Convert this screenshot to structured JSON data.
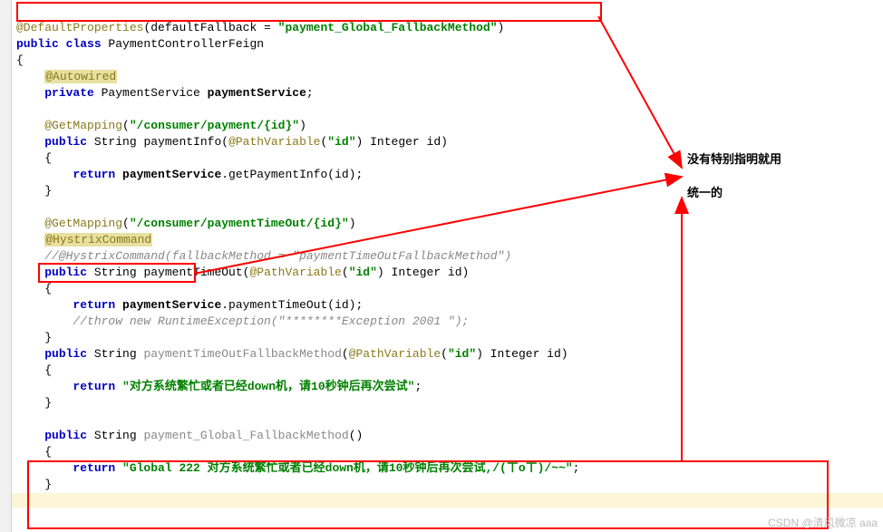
{
  "lines": {
    "l1a": "@DefaultProperties",
    "l1b": "(defaultFallback = ",
    "l1c": "\"payment_Global_FallbackMethod\"",
    "l1d": ")",
    "l2a": "public",
    "l2b": " class",
    "l2c": " PaymentControllerFeign",
    "l3": "{",
    "l4": "@Autowired",
    "l5a": "private",
    "l5b": " PaymentService ",
    "l5c": "paymentService",
    "l5d": ";",
    "l7a": "@GetMapping",
    "l7b": "(",
    "l7c": "\"/consumer/payment/{id}\"",
    "l7d": ")",
    "l8a": "public",
    "l8b": " String paymentInfo(",
    "l8c": "@PathVariable",
    "l8d": "(",
    "l8e": "\"id\"",
    "l8f": ") Integer id)",
    "l9": "{",
    "l10a": "return ",
    "l10b": "paymentService",
    "l10c": ".getPaymentInfo(id);",
    "l11": "}",
    "l13a": "@GetMapping",
    "l13b": "(",
    "l13c": "\"/consumer/paymentTimeOut/{id}\"",
    "l13d": ")",
    "l14": "@HystrixCommand",
    "l15": "//@HystrixCommand(fallbackMethod = \"paymentTimeOutFallbackMethod\")",
    "l16a": "public",
    "l16b": " String paymentTimeOut(",
    "l16c": "@PathVariable",
    "l16d": "(",
    "l16e": "\"id\"",
    "l16f": ") Integer id)",
    "l17": "{",
    "l18a": "return ",
    "l18b": "paymentService",
    "l18c": ".paymentTimeOut(id);",
    "l19": "//throw new RuntimeException(\"********Exception 2001 \");",
    "l20": "}",
    "l21a": "public",
    "l21b": " String ",
    "l21c": "paymentTimeOutFallbackMethod",
    "l21d": "(",
    "l21e": "@PathVariable",
    "l21f": "(",
    "l21g": "\"id\"",
    "l21h": ") Integer id)",
    "l22": "{",
    "l23a": "return ",
    "l23b": "\"对方系统繁忙或者已经down机，请10秒钟后再次尝试\"",
    "l23c": ";",
    "l24": "}",
    "l26a": "public",
    "l26b": " String ",
    "l26c": "payment_Global_FallbackMethod",
    "l26d": "()",
    "l27": "{",
    "l28a": "return ",
    "l28b": "\"Global 222 对方系统繁忙或者已经down机，请10秒钟后再次尝试,/(ㄒoㄒ)/~~\"",
    "l28c": ";",
    "l29": "}"
  },
  "annotations": {
    "line1": "没有特别指明就用",
    "line2": "统一的"
  },
  "watermark": "CSDN @清风微凉 aaa"
}
